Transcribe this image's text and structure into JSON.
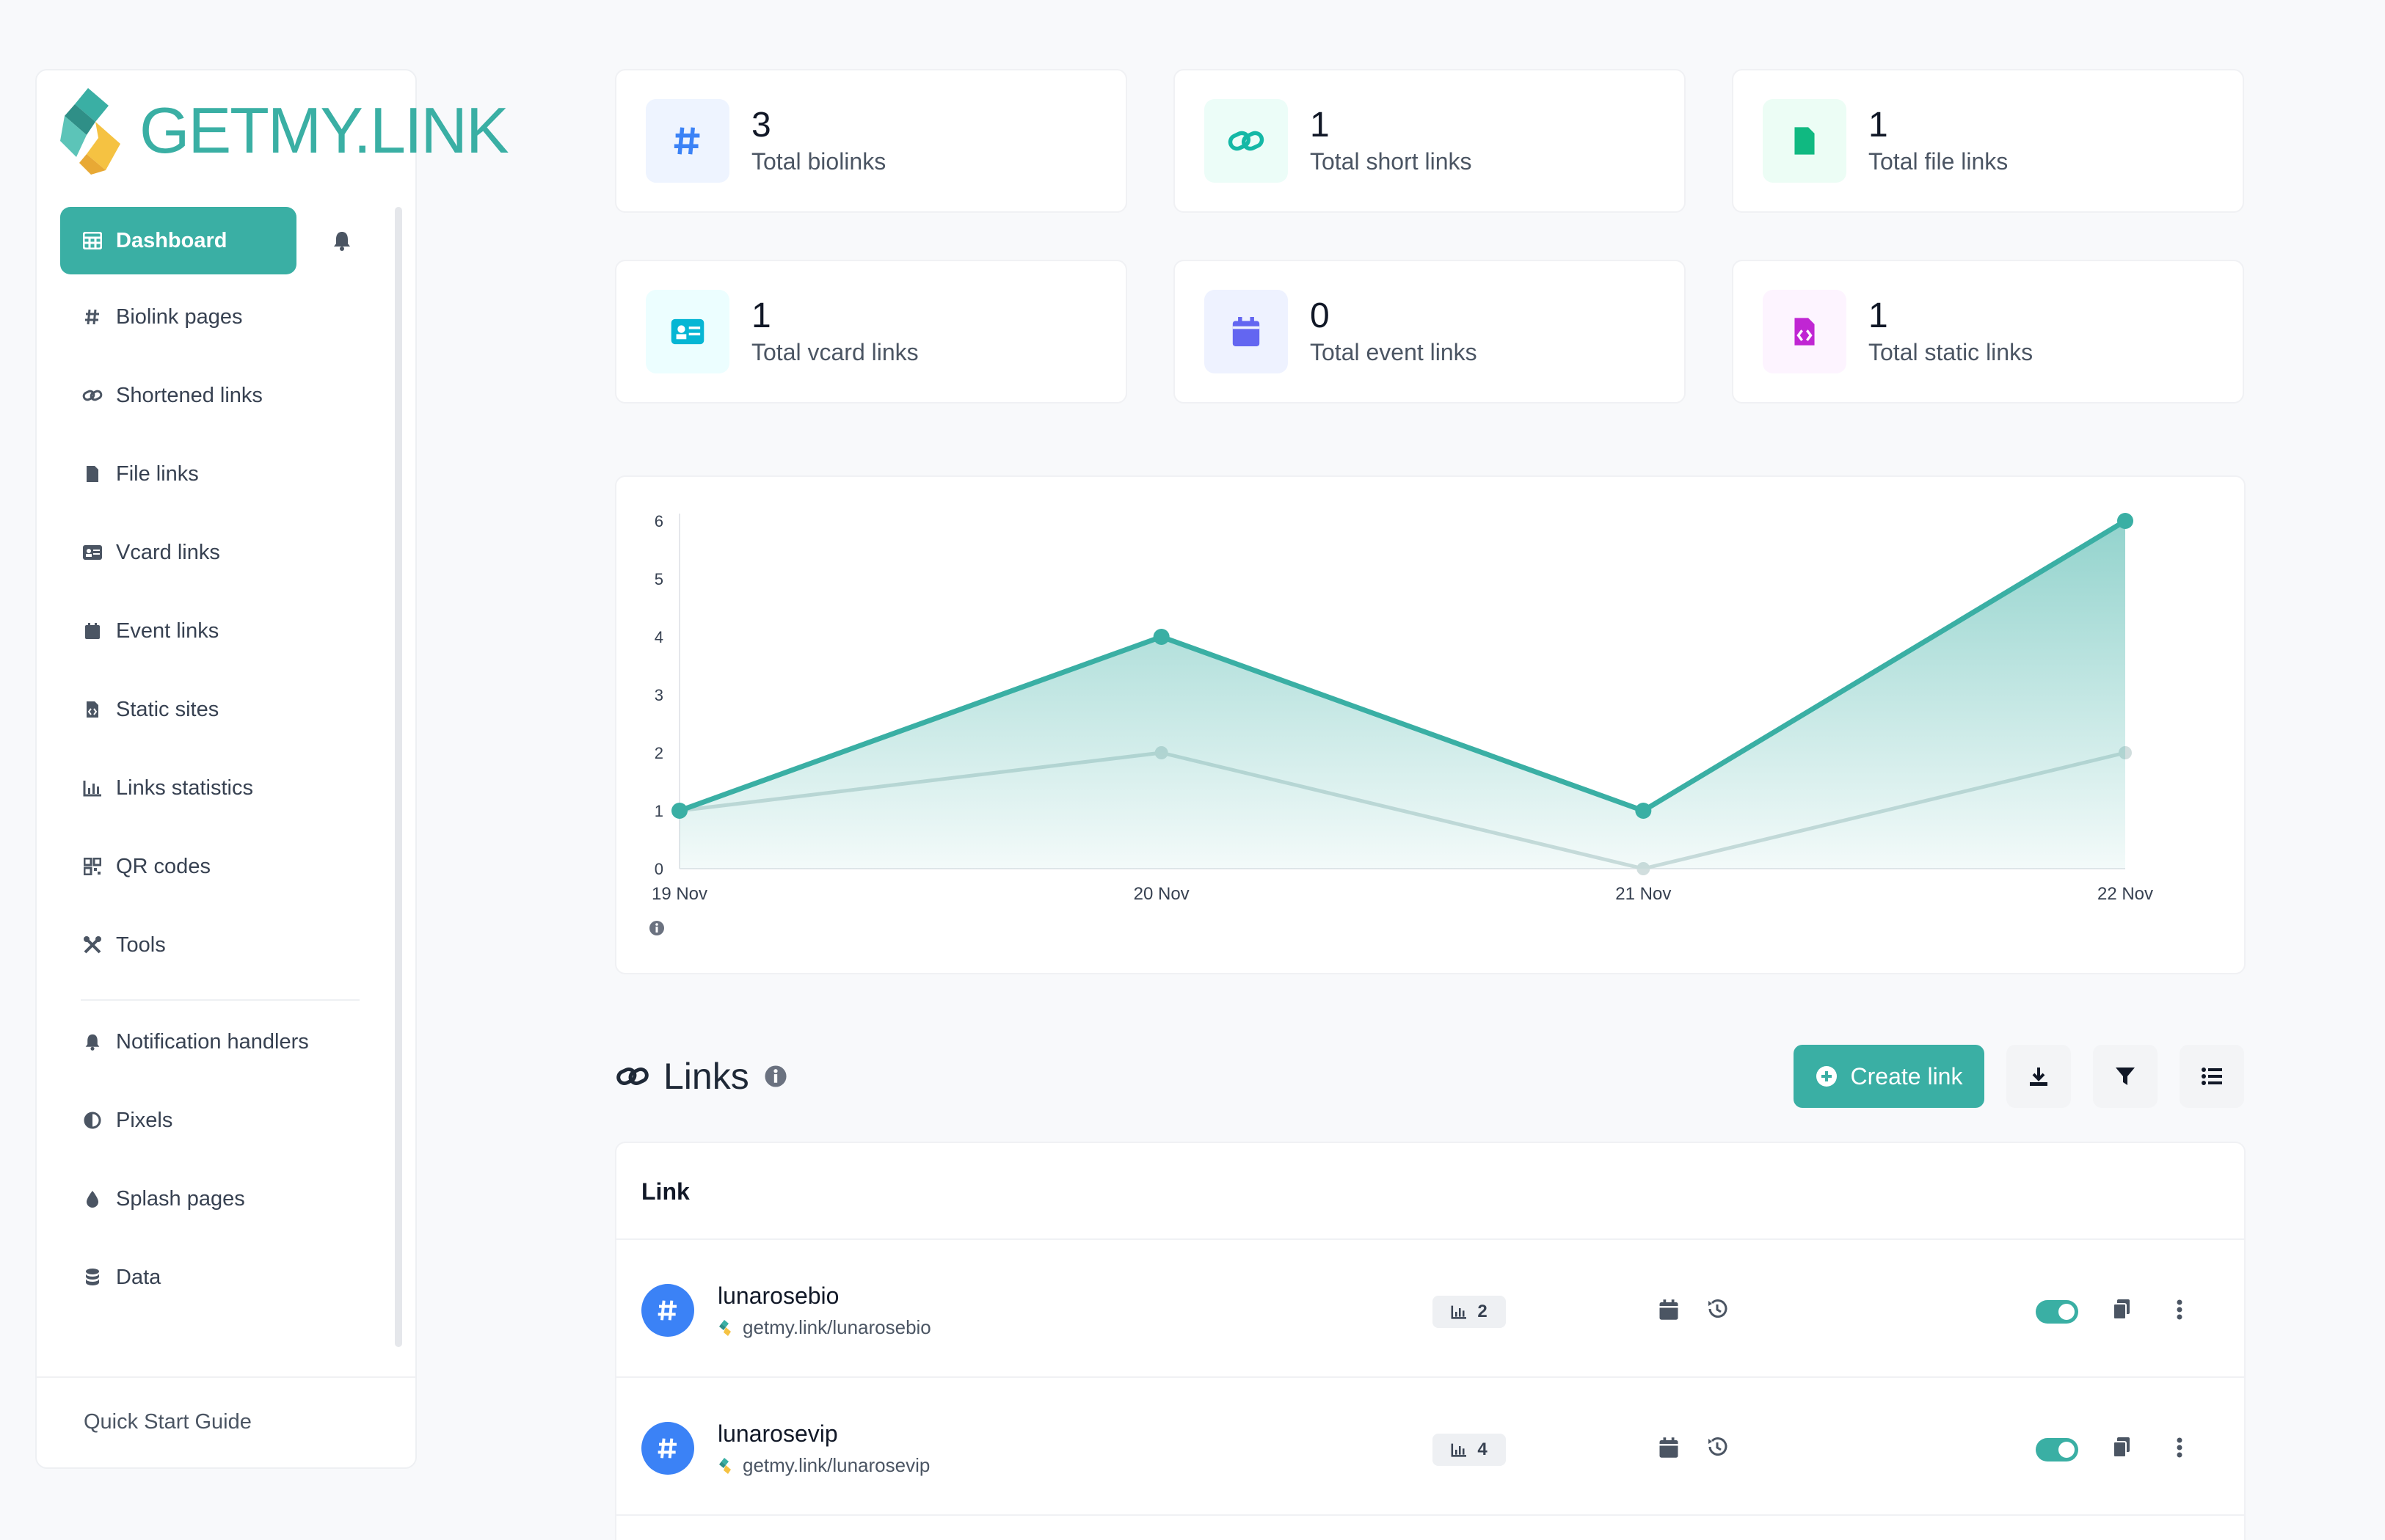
{
  "brand": {
    "name": "GETMY.LINK",
    "accent": "#3aafa4"
  },
  "sidebar": {
    "items": [
      {
        "label": "Dashboard",
        "icon": "table-icon",
        "active": true
      },
      {
        "label": "Biolink pages",
        "icon": "hashtag-icon"
      },
      {
        "label": "Shortened links",
        "icon": "link-icon"
      },
      {
        "label": "File links",
        "icon": "file-icon"
      },
      {
        "label": "Vcard links",
        "icon": "id-card-icon"
      },
      {
        "label": "Event links",
        "icon": "calendar-icon"
      },
      {
        "label": "Static sites",
        "icon": "file-code-icon"
      },
      {
        "label": "Links statistics",
        "icon": "chart-icon"
      },
      {
        "label": "QR codes",
        "icon": "qrcode-icon"
      },
      {
        "label": "Tools",
        "icon": "tools-icon"
      }
    ],
    "secondary_items": [
      {
        "label": "Notification handlers",
        "icon": "bell-icon"
      },
      {
        "label": "Pixels",
        "icon": "adjust-icon"
      },
      {
        "label": "Splash pages",
        "icon": "droplet-icon"
      },
      {
        "label": "Data",
        "icon": "database-icon"
      }
    ],
    "quick_start": "Quick Start Guide"
  },
  "stats": [
    {
      "value": "3",
      "label": "Total biolinks",
      "icon": "hashtag-icon",
      "color": "#3b82f6",
      "bg": "#eef4ff"
    },
    {
      "value": "1",
      "label": "Total short links",
      "icon": "link-icon",
      "color": "#14b8a6",
      "bg": "#ecfdf8"
    },
    {
      "value": "1",
      "label": "Total file links",
      "icon": "file-icon",
      "color": "#10b981",
      "bg": "#ecfdf5"
    },
    {
      "value": "1",
      "label": "Total vcard links",
      "icon": "id-card-icon",
      "color": "#06b6d4",
      "bg": "#ecfeff"
    },
    {
      "value": "0",
      "label": "Total event links",
      "icon": "calendar-icon",
      "color": "#6366f1",
      "bg": "#eef2ff"
    },
    {
      "value": "1",
      "label": "Total static links",
      "icon": "file-code-icon",
      "color": "#c026d3",
      "bg": "#fdf4ff"
    }
  ],
  "chart_data": {
    "type": "line",
    "categories": [
      "19 Nov",
      "20 Nov",
      "21 Nov",
      "22 Nov"
    ],
    "series": [
      {
        "values": [
          1,
          4,
          1,
          6
        ],
        "color": "#3aafa4",
        "filled": true
      },
      {
        "values": [
          1,
          2,
          0,
          2
        ],
        "color": "#d1dede",
        "filled": false
      }
    ],
    "ylim": [
      0,
      6
    ],
    "yticks": [
      0,
      1,
      2,
      3,
      4,
      5,
      6
    ],
    "grid": false,
    "legend": "none"
  },
  "links": {
    "title": "Links",
    "create_label": "Create link",
    "column_header": "Link",
    "rows": [
      {
        "name": "lunarosebio",
        "url": "getmy.link/lunarosebio",
        "clicks": "2",
        "enabled": true
      },
      {
        "name": "lunarosevip",
        "url": "getmy.link/lunarosevip",
        "clicks": "4",
        "enabled": true
      }
    ]
  }
}
